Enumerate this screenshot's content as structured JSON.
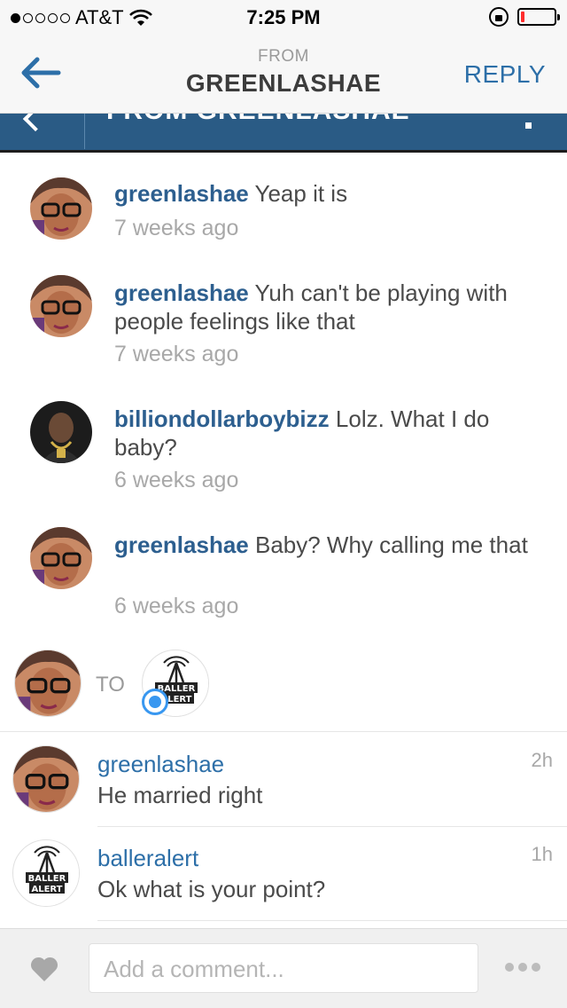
{
  "status_bar": {
    "carrier": "AT&T",
    "time": "7:25 PM",
    "signal_bars_filled": 1,
    "signal_bars_total": 5,
    "battery_level": 0.12
  },
  "nav": {
    "subtitle": "FROM",
    "title": "GREENLASHAE",
    "reply_label": "REPLY",
    "back_icon": "back-arrow-icon"
  },
  "embedded_screenshot": {
    "header_text": "FROM GREENLASHAE",
    "comments": [
      {
        "user": "greenlashae",
        "text": "Yeap it is",
        "time": "7 weeks ago"
      },
      {
        "user": "greenlashae",
        "text": "Yuh can't be playing with people feelings like that",
        "time": "7 weeks ago"
      },
      {
        "user": "billiondollarboybizz",
        "text": "Lolz. What I do baby?",
        "time": "6 weeks ago"
      },
      {
        "user": "greenlashae",
        "text": "Baby? Why calling me that",
        "time": "6 weeks ago"
      }
    ]
  },
  "to_row": {
    "to_label": "TO",
    "recipient_logo_text": [
      "BALLER",
      "ALERT"
    ]
  },
  "comments": [
    {
      "user": "greenlashae",
      "text": "He married right",
      "time": "2h"
    },
    {
      "user": "balleralert",
      "text": "Ok what is your point?",
      "time": "1h"
    }
  ],
  "composer": {
    "placeholder": "Add a comment...",
    "heart_icon": "heart-icon",
    "more_icon": "more-dots-icon"
  },
  "colors": {
    "accent": "#2d6fa8",
    "embed_bar": "#2a5b85",
    "battery_low": "#ff2d2d",
    "unread_badge": "#3897f0"
  }
}
